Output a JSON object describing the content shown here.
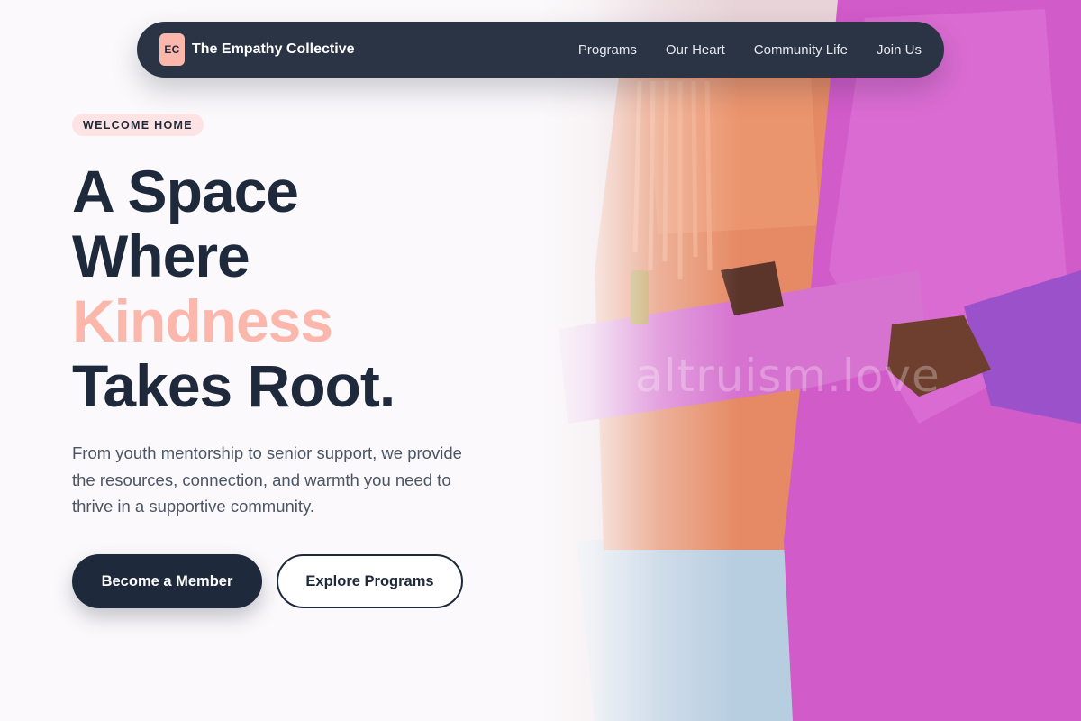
{
  "nav": {
    "logo_initials": "EC",
    "brand_name": "The Empathy Collective",
    "links": [
      "Programs",
      "Our Heart",
      "Community Life",
      "Join Us"
    ]
  },
  "hero": {
    "eyebrow": "WELCOME HOME",
    "headline": {
      "line1": "A Space",
      "line2": "Where",
      "line3_accent": "Kindness",
      "line4": "Takes Root."
    },
    "description": "From youth mentorship to senior support, we provide the resources, connection, and warmth you need to thrive in a supportive community.",
    "primary_cta": "Become a Member",
    "secondary_cta": "Explore Programs"
  },
  "image": {
    "subject": "people-embracing-photo",
    "watermark": "altruism.love"
  },
  "colors": {
    "navy": "#1e293b",
    "nav_bg": "#2b3444",
    "accent_peach": "#fbb7ab",
    "pill_bg": "#fde3e3",
    "page_bg": "#fbf9fb"
  }
}
